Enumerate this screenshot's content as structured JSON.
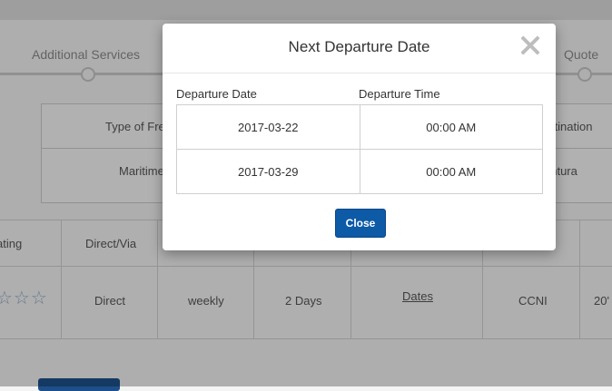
{
  "background": {
    "steps": [
      "Additional Services",
      "Quote"
    ],
    "summary": {
      "type_of_freight_label": "Type of Frei",
      "destination_label": "stination",
      "freight_value": "Maritime",
      "destination_value": "entura"
    },
    "results": {
      "headers": [
        "ating",
        "Direct/Via"
      ],
      "row": {
        "stars": "☆☆☆",
        "direct": "Direct",
        "frequency": "weekly",
        "transit": "2 Days",
        "dates_link": "Dates",
        "carrier": "CCNI",
        "container": "20'"
      }
    }
  },
  "modal": {
    "title": "Next Departure Date",
    "columns": [
      "Departure Date",
      "Departure Time"
    ],
    "rows": [
      {
        "date": "2017-03-22",
        "time": "00:00 AM"
      },
      {
        "date": "2017-03-29",
        "time": "00:00 AM"
      }
    ],
    "close_label": "Close"
  },
  "colors": {
    "primary_button": "#0d5aa7",
    "link": "#2e5d93"
  }
}
